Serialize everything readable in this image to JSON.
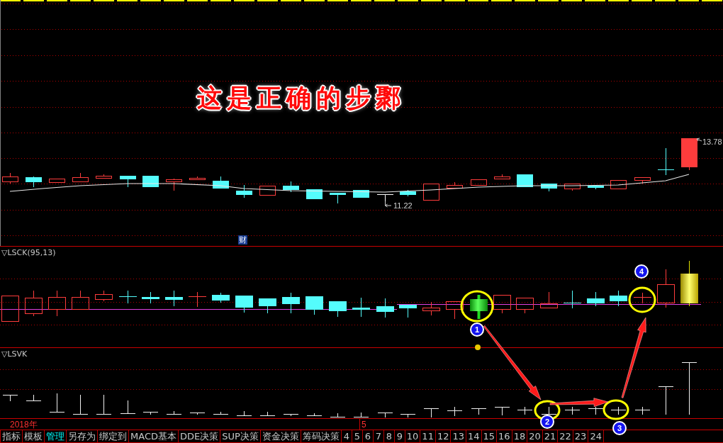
{
  "annotation_title": "这是正确的步鄹",
  "main_chart": {
    "high_label": "13.78",
    "low_label": "11.22",
    "finance_marker": "财"
  },
  "indicator_panels": [
    {
      "label": "▽LSCK(95,13)"
    },
    {
      "label": "▽LSVK"
    }
  ],
  "date_axis": {
    "year": "2018年",
    "month": "5"
  },
  "tabs": [
    {
      "label": "指标",
      "selected": false
    },
    {
      "label": "模板",
      "selected": false
    },
    {
      "label": "管理",
      "selected": true
    },
    {
      "label": "另存为",
      "selected": false
    },
    {
      "label": "绑定到",
      "selected": false
    },
    {
      "label": "MACD基本",
      "selected": false
    },
    {
      "label": "DDE决策",
      "selected": false
    },
    {
      "label": "SUP决策",
      "selected": false
    },
    {
      "label": "资金决策",
      "selected": false
    },
    {
      "label": "筹码决策",
      "selected": false
    },
    {
      "label": "4",
      "selected": false
    },
    {
      "label": "5",
      "selected": false
    },
    {
      "label": "6",
      "selected": false
    },
    {
      "label": "7",
      "selected": false
    },
    {
      "label": "8",
      "selected": false
    },
    {
      "label": "9",
      "selected": false
    },
    {
      "label": "10",
      "selected": false
    },
    {
      "label": "11",
      "selected": false
    },
    {
      "label": "12",
      "selected": false
    },
    {
      "label": "13",
      "selected": false
    },
    {
      "label": "14",
      "selected": false
    },
    {
      "label": "15",
      "selected": false
    },
    {
      "label": "16",
      "selected": false
    },
    {
      "label": "18",
      "selected": false
    },
    {
      "label": "20",
      "selected": false
    },
    {
      "label": "21",
      "selected": false
    },
    {
      "label": "22",
      "selected": false
    },
    {
      "label": "23",
      "selected": false
    },
    {
      "label": "24",
      "selected": false
    }
  ],
  "callouts": [
    {
      "number": "1"
    },
    {
      "number": "2"
    },
    {
      "number": "3"
    },
    {
      "number": "4"
    }
  ]
}
